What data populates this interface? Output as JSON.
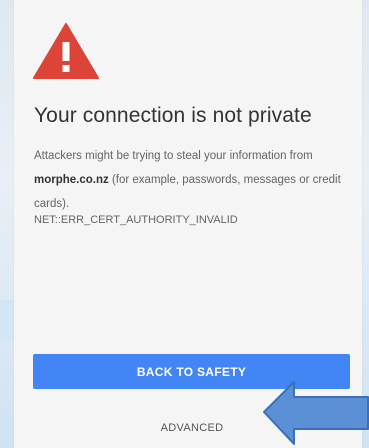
{
  "page": {
    "title": "Your connection is not private",
    "description_pre": "Attackers might be trying to steal your information from ",
    "domain": "morphe.co.nz",
    "description_post": " (for example, passwords, messages or credit cards).",
    "error_code": "NET::ERR_CERT_AUTHORITY_INVALID"
  },
  "buttons": {
    "back_to_safety": "BACK TO SAFETY",
    "advanced": "ADVANCED"
  },
  "icons": {
    "warning": "warning-triangle-icon",
    "pointer": "arrow-left-icon"
  },
  "colors": {
    "warning_red": "#db4437",
    "primary_button": "#4285f4",
    "arrow_fill": "#5b8fd6",
    "arrow_stroke": "#3c6fb8"
  }
}
